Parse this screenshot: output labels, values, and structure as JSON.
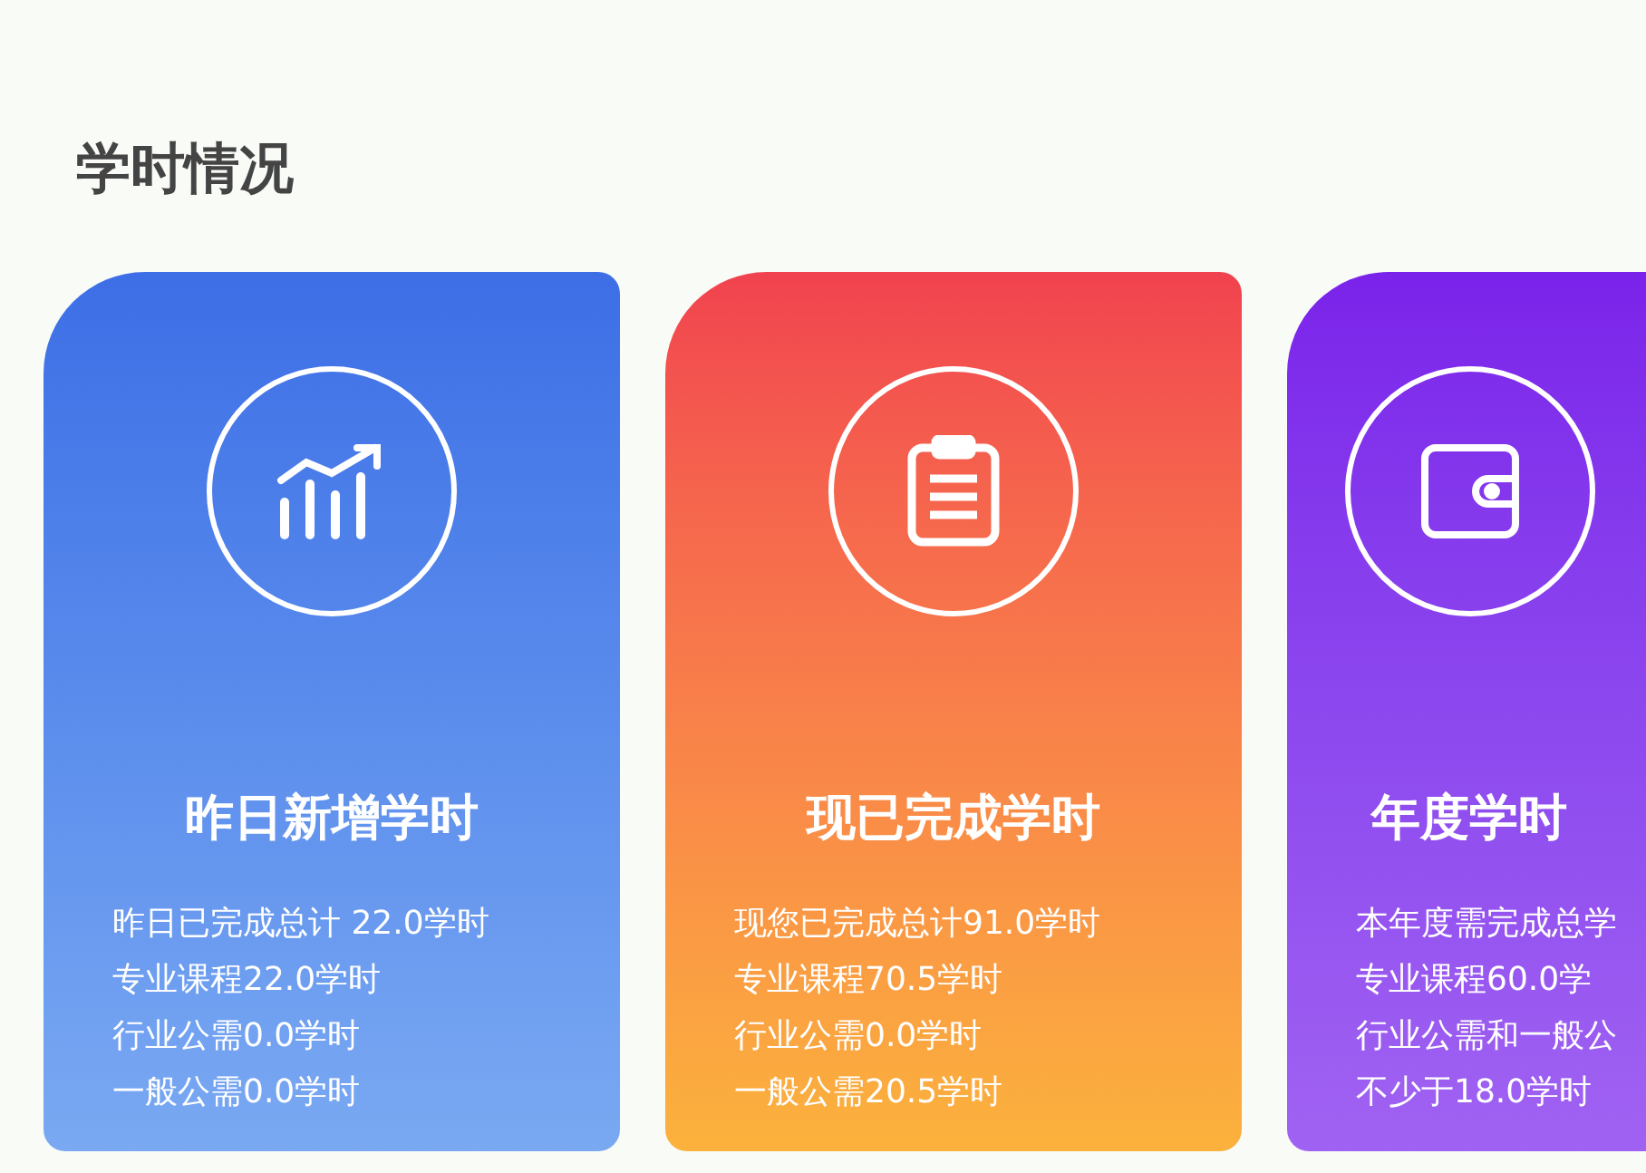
{
  "heading": "学时情况",
  "cards": [
    {
      "kind": "chart",
      "title": "昨日新增学时",
      "lines": [
        "昨日已完成总计 22.0学时",
        "专业课程22.0学时",
        "行业公需0.0学时",
        "一般公需0.0学时"
      ]
    },
    {
      "kind": "clipboard",
      "title": "现已完成学时",
      "lines": [
        "现您已完成总计91.0学时",
        "专业课程70.5学时",
        "行业公需0.0学时",
        "一般公需20.5学时"
      ]
    },
    {
      "kind": "wallet",
      "title": "年度学时",
      "lines": [
        "本年度需完成总学",
        "专业课程60.0学",
        "行业公需和一般公",
        "不少于18.0学时"
      ]
    }
  ]
}
